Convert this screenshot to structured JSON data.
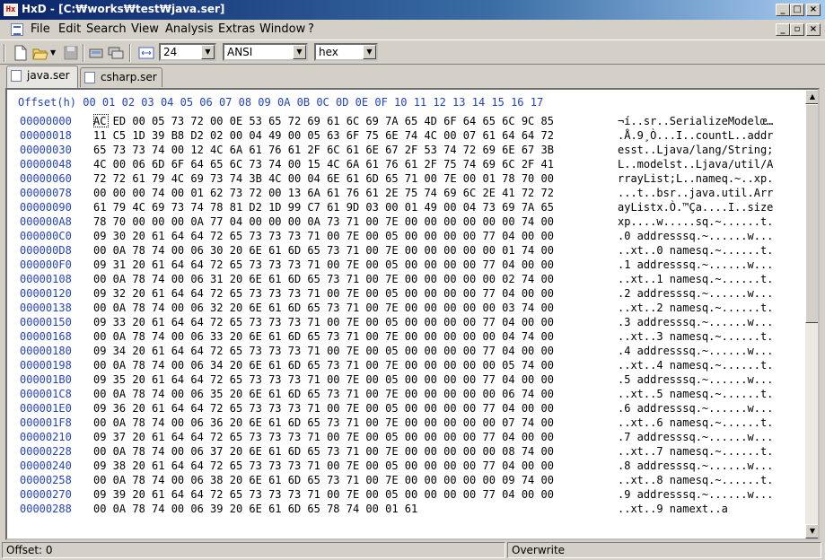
{
  "window": {
    "title": "HxD - [C:₩works₩test₩java.ser]"
  },
  "menu": [
    "File",
    "Edit",
    "Search",
    "View",
    "Analysis",
    "Extras",
    "Window",
    "?"
  ],
  "toolbar": {
    "bytes_per_row": "24",
    "charset": "ANSI",
    "offset_base": "hex",
    "icons": [
      "new-file-icon",
      "open-folder-icon",
      "save-disk-icon",
      "disk-icon",
      "multi-disk-icon",
      "bytes-per-row-icon"
    ]
  },
  "tabs": [
    {
      "label": "java.ser",
      "active": true
    },
    {
      "label": "csharp.ser",
      "active": false
    }
  ],
  "hex_editor": {
    "header": "Offset(h) 00 01 02 03 04 05 06 07 08 09 0A 0B 0C 0D 0E 0F 10 11 12 13 14 15 16 17",
    "rows": [
      {
        "offset": "00000000",
        "hex": "AC ED 00 05 73 72 00 0E 53 65 72 69 61 6C 69 7A 65 4D 6F 64 65 6C 9C 85",
        "text": "¬í..sr..SerializeModelœ…"
      },
      {
        "offset": "00000018",
        "hex": "11 C5 1D 39 B8 D2 02 00 04 49 00 05 63 6F 75 6E 74 4C 00 07 61 64 64 72",
        "text": ".Å.9¸Ò...I..countL..addr"
      },
      {
        "offset": "00000030",
        "hex": "65 73 73 74 00 12 4C 6A 61 76 61 2F 6C 61 6E 67 2F 53 74 72 69 6E 67 3B",
        "text": "esst..Ljava/lang/String;"
      },
      {
        "offset": "00000048",
        "hex": "4C 00 06 6D 6F 64 65 6C 73 74 00 15 4C 6A 61 76 61 2F 75 74 69 6C 2F 41",
        "text": "L..modelst..Ljava/util/A"
      },
      {
        "offset": "00000060",
        "hex": "72 72 61 79 4C 69 73 74 3B 4C 00 04 6E 61 6D 65 71 00 7E 00 01 78 70 00",
        "text": "rrayList;L..nameq.~..xp."
      },
      {
        "offset": "00000078",
        "hex": "00 00 00 74 00 01 62 73 72 00 13 6A 61 76 61 2E 75 74 69 6C 2E 41 72 72",
        "text": "...t..bsr..java.util.Arr"
      },
      {
        "offset": "00000090",
        "hex": "61 79 4C 69 73 74 78 81 D2 1D 99 C7 61 9D 03 00 01 49 00 04 73 69 7A 65",
        "text": "ayListx.Ò.™Ça....I..size"
      },
      {
        "offset": "000000A8",
        "hex": "78 70 00 00 00 0A 77 04 00 00 00 0A 73 71 00 7E 00 00 00 00 00 00 74 00",
        "text": "xp....w.....sq.~......t."
      },
      {
        "offset": "000000C0",
        "hex": "09 30 20 61 64 64 72 65 73 73 73 71 00 7E 00 05 00 00 00 00 77 04 00 00",
        "text": ".0 addresssq.~......w..."
      },
      {
        "offset": "000000D8",
        "hex": "00 0A 78 74 00 06 30 20 6E 61 6D 65 73 71 00 7E 00 00 00 00 00 01 74 00",
        "text": "..xt..0 namesq.~......t."
      },
      {
        "offset": "000000F0",
        "hex": "09 31 20 61 64 64 72 65 73 73 73 71 00 7E 00 05 00 00 00 00 77 04 00 00",
        "text": ".1 addresssq.~......w..."
      },
      {
        "offset": "00000108",
        "hex": "00 0A 78 74 00 06 31 20 6E 61 6D 65 73 71 00 7E 00 00 00 00 00 02 74 00",
        "text": "..xt..1 namesq.~......t."
      },
      {
        "offset": "00000120",
        "hex": "09 32 20 61 64 64 72 65 73 73 73 71 00 7E 00 05 00 00 00 00 77 04 00 00",
        "text": ".2 addresssq.~......w..."
      },
      {
        "offset": "00000138",
        "hex": "00 0A 78 74 00 06 32 20 6E 61 6D 65 73 71 00 7E 00 00 00 00 00 03 74 00",
        "text": "..xt..2 namesq.~......t."
      },
      {
        "offset": "00000150",
        "hex": "09 33 20 61 64 64 72 65 73 73 73 71 00 7E 00 05 00 00 00 00 77 04 00 00",
        "text": ".3 addresssq.~......w..."
      },
      {
        "offset": "00000168",
        "hex": "00 0A 78 74 00 06 33 20 6E 61 6D 65 73 71 00 7E 00 00 00 00 00 04 74 00",
        "text": "..xt..3 namesq.~......t."
      },
      {
        "offset": "00000180",
        "hex": "09 34 20 61 64 64 72 65 73 73 73 71 00 7E 00 05 00 00 00 00 77 04 00 00",
        "text": ".4 addresssq.~......w..."
      },
      {
        "offset": "00000198",
        "hex": "00 0A 78 74 00 06 34 20 6E 61 6D 65 73 71 00 7E 00 00 00 00 00 05 74 00",
        "text": "..xt..4 namesq.~......t."
      },
      {
        "offset": "000001B0",
        "hex": "09 35 20 61 64 64 72 65 73 73 73 71 00 7E 00 05 00 00 00 00 77 04 00 00",
        "text": ".5 addresssq.~......w..."
      },
      {
        "offset": "000001C8",
        "hex": "00 0A 78 74 00 06 35 20 6E 61 6D 65 73 71 00 7E 00 00 00 00 00 06 74 00",
        "text": "..xt..5 namesq.~......t."
      },
      {
        "offset": "000001E0",
        "hex": "09 36 20 61 64 64 72 65 73 73 73 71 00 7E 00 05 00 00 00 00 77 04 00 00",
        "text": ".6 addresssq.~......w..."
      },
      {
        "offset": "000001F8",
        "hex": "00 0A 78 74 00 06 36 20 6E 61 6D 65 73 71 00 7E 00 00 00 00 00 07 74 00",
        "text": "..xt..6 namesq.~......t."
      },
      {
        "offset": "00000210",
        "hex": "09 37 20 61 64 64 72 65 73 73 73 71 00 7E 00 05 00 00 00 00 77 04 00 00",
        "text": ".7 addresssq.~......w..."
      },
      {
        "offset": "00000228",
        "hex": "00 0A 78 74 00 06 37 20 6E 61 6D 65 73 71 00 7E 00 00 00 00 00 08 74 00",
        "text": "..xt..7 namesq.~......t."
      },
      {
        "offset": "00000240",
        "hex": "09 38 20 61 64 64 72 65 73 73 73 71 00 7E 00 05 00 00 00 00 77 04 00 00",
        "text": ".8 addresssq.~......w..."
      },
      {
        "offset": "00000258",
        "hex": "00 0A 78 74 00 06 38 20 6E 61 6D 65 73 71 00 7E 00 00 00 00 00 09 74 00",
        "text": "..xt..8 namesq.~......t."
      },
      {
        "offset": "00000270",
        "hex": "09 39 20 61 64 64 72 65 73 73 73 71 00 7E 00 05 00 00 00 00 77 04 00 00",
        "text": ".9 addresssq.~......w..."
      },
      {
        "offset": "00000288",
        "hex": "00 0A 78 74 00 06 39 20 6E 61 6D 65 78 74 00 01 61",
        "text": "..xt..9 namext..a"
      }
    ]
  },
  "status": {
    "offset": "Offset: 0",
    "mode": "Overwrite"
  }
}
